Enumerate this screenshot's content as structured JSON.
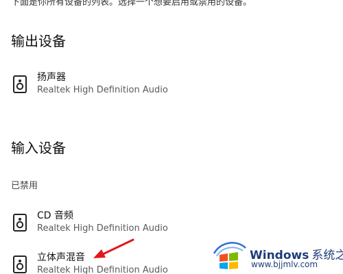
{
  "intro_text": "下面是你所有设备的列表。选择一个想要启用或禁用的设备。",
  "output_section": {
    "title": "输出设备",
    "devices": [
      {
        "name": "扬声器",
        "driver": "Realtek High Definition Audio",
        "icon": "speaker-icon"
      }
    ]
  },
  "input_section": {
    "title": "输入设备",
    "group_label": "已禁用",
    "devices": [
      {
        "name": "CD 音频",
        "driver": "Realtek High Definition Audio",
        "icon": "speaker-icon"
      },
      {
        "name": "立体声混音",
        "driver": "Realtek High Definition Audio",
        "icon": "speaker-icon"
      }
    ]
  },
  "watermark": {
    "brand": "Windows",
    "brand_cn": "系统之家",
    "url": "www.bjjmlv.com"
  },
  "colors": {
    "arrow": "#e0191e",
    "brand": "#1f3d7a"
  }
}
